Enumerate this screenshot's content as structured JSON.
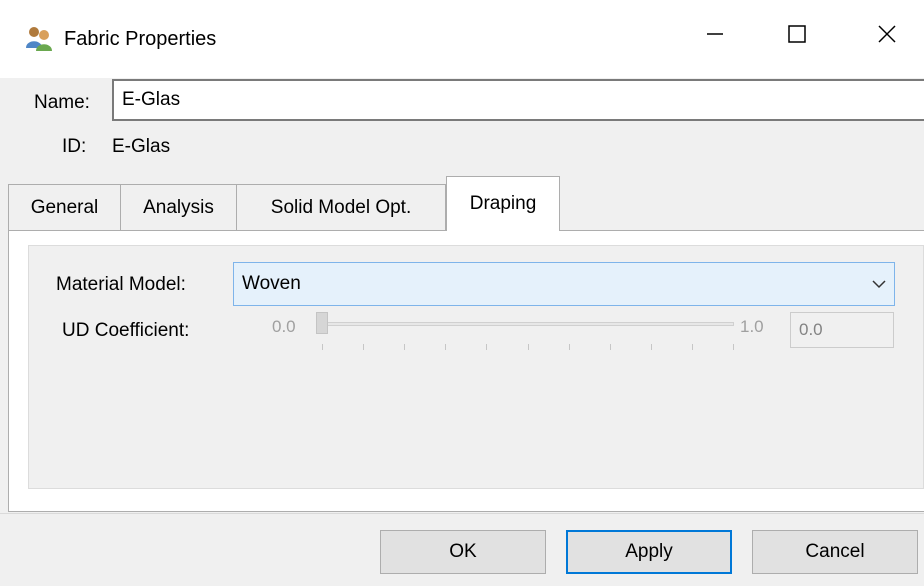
{
  "window": {
    "title": "Fabric Properties",
    "icon": "fabric-properties-icon",
    "controls": {
      "minimize": "minimize-icon",
      "maximize": "maximize-icon",
      "close": "close-icon"
    }
  },
  "fields": {
    "name_label": "Name:",
    "name_value": "E-Glas",
    "id_label": "ID:",
    "id_value": "E-Glas"
  },
  "tabs": [
    {
      "label": "General",
      "active": false
    },
    {
      "label": "Analysis",
      "active": false
    },
    {
      "label": "Solid Model Opt.",
      "active": false
    },
    {
      "label": "Draping",
      "active": true
    }
  ],
  "draping": {
    "material_model_label": "Material Model:",
    "material_model_value": "Woven",
    "ud_coefficient_label": "UD Coefficient:",
    "slider_min_label": "0.0",
    "slider_max_label": "1.0",
    "slider_value_fraction": 0.0,
    "ud_coefficient_value": "0.0"
  },
  "buttons": {
    "ok": "OK",
    "apply": "Apply",
    "cancel": "Cancel"
  },
  "colors": {
    "default_button_border": "#0078d7",
    "combo_highlight": "#e5f1fb"
  }
}
